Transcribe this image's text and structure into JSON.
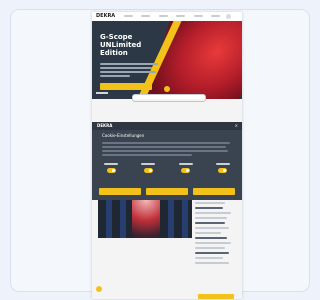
{
  "site": {
    "logo": "DEKRA"
  },
  "hero": {
    "title": "G-Scope UNLimited Edition",
    "button_label": ""
  },
  "consent_modal": {
    "brand": "DEKRA",
    "title": "Cookie-Einstellungen",
    "close_label": "×",
    "toggles": [
      {
        "on": true
      },
      {
        "on": true
      },
      {
        "on": true
      },
      {
        "on": true
      }
    ],
    "buttons": [
      "",
      "",
      ""
    ]
  },
  "colors": {
    "accent": "#f2c21b",
    "hero_bg": "#2c3845",
    "modal_bg": "#3a4350",
    "hero_red": "#c0303a"
  },
  "icons": {
    "float_button": "chat-icon",
    "nav_button": "menu-icon"
  }
}
